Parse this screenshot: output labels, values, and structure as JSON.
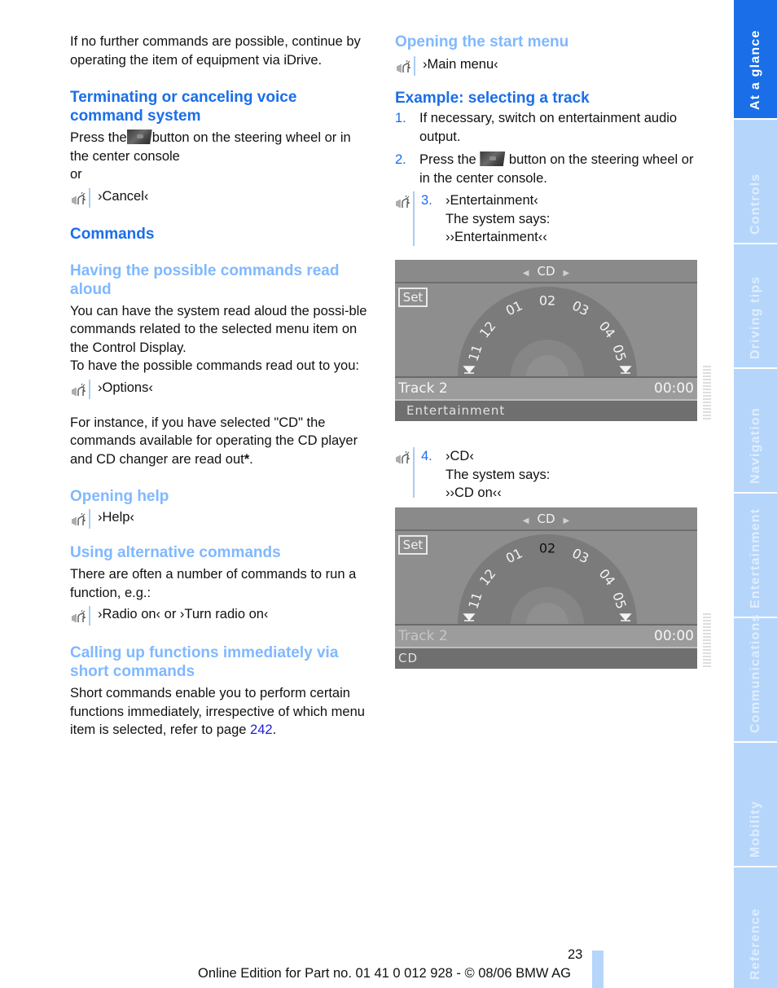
{
  "left": {
    "intro": "If no further commands are possible, continue by operating the item of equipment via iDrive.",
    "terminating": {
      "heading": "Terminating or canceling voice command system",
      "text_before": "Press the",
      "button_icon": "voice-button-image",
      "text_after": "button on the steering wheel or in the center console",
      "or": "or",
      "command": "›Cancel‹"
    },
    "commands_heading": "Commands",
    "read_aloud": {
      "heading": "Having the possible commands read aloud",
      "text1": "You can have the system read aloud the possi-ble commands related to the selected menu item on the Control Display.",
      "text2": "To have the possible commands read out to you:",
      "command": "›Options‹",
      "text3_before": "For instance, if you have selected \"CD\" the commands available for operating the CD player and CD changer are read out",
      "asterisk": "*",
      "text3_after": "."
    },
    "help": {
      "heading": "Opening help",
      "command": "›Help‹"
    },
    "alternative": {
      "heading": "Using alternative commands",
      "text": "There are often a number of commands to run a function, e.g.:",
      "command1": "›Radio on‹",
      "or": "or",
      "command2": "›Turn radio on‹"
    },
    "short": {
      "heading": "Calling up functions immediately via short commands",
      "text_before": "Short commands enable you to perform certain functions immediately, irrespective of which menu item is selected, refer to page",
      "page_link": "242",
      "text_after": "."
    }
  },
  "right": {
    "start_menu": {
      "heading": "Opening the start menu",
      "command": "›Main menu‹"
    },
    "example": {
      "heading": "Example: selecting a track",
      "steps": [
        {
          "num": "1.",
          "text": "If necessary, switch on entertainment audio output."
        },
        {
          "num": "2.",
          "text_before": "Press the",
          "text_after": "button on the steering wheel or in the center console."
        },
        {
          "num": "3.",
          "command": "›Entertainment‹",
          "says_label": "The system says:",
          "says": "››Entertainment‹‹"
        },
        {
          "num": "4.",
          "command": "›CD‹",
          "says_label": "The system says:",
          "says": "››CD on‹‹"
        }
      ]
    },
    "screens": [
      {
        "top_label": "CD",
        "set_label": "Set",
        "tracks": [
          "11",
          "12",
          "01",
          "02",
          "03",
          "04",
          "05"
        ],
        "selected_track": "02",
        "track_label": "Track 2",
        "time": "00:00",
        "status": "Entertainment"
      },
      {
        "top_label": "CD",
        "set_label": "Set",
        "tracks": [
          "11",
          "12",
          "01",
          "02",
          "03",
          "04",
          "05"
        ],
        "selected_track": "02",
        "track_label": "Track 2",
        "time": "00:00",
        "status": "CD"
      }
    ]
  },
  "side_tabs": [
    {
      "label": "At a glance",
      "active": true
    },
    {
      "label": "Controls",
      "active": false
    },
    {
      "label": "Driving tips",
      "active": false
    },
    {
      "label": "Navigation",
      "active": false
    },
    {
      "label": "Entertainment",
      "active": false
    },
    {
      "label": "Communications",
      "active": false
    },
    {
      "label": "Mobility",
      "active": false
    },
    {
      "label": "Reference",
      "active": false
    }
  ],
  "footer": {
    "page_number": "23",
    "text": "Online Edition for Part no. 01 41 0 012 928 - © 08/06 BMW AG"
  },
  "colors": {
    "heading_blue": "#1a6ee8",
    "subheading_blue": "#80b8ff",
    "tab_light": "#b6d5fb",
    "link": "#1d1de0"
  }
}
